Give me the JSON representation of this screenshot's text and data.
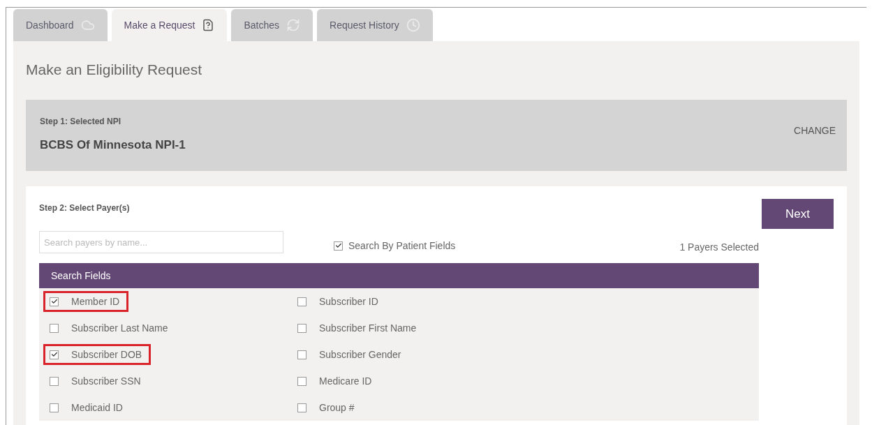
{
  "tabs": [
    {
      "label": "Dashboard",
      "selected": false
    },
    {
      "label": "Make a Request",
      "selected": true
    },
    {
      "label": "Batches",
      "selected": false
    },
    {
      "label": "Request History",
      "selected": false
    }
  ],
  "page_title": "Make an Eligibility Request",
  "step1": {
    "heading": "Step 1: Selected NPI",
    "value": "BCBS Of Minnesota NPI-1",
    "action": "CHANGE"
  },
  "step2": {
    "heading": "Step 2: Select Payer(s)",
    "search": {
      "placeholder": "Search payers by name..."
    },
    "patient_fields": {
      "label": "Search By Patient Fields",
      "checked": true
    },
    "count": "1 Payers Selected",
    "next": "Next",
    "section_title": "Search Fields",
    "fields": [
      {
        "label": "Member ID",
        "checked": true,
        "highlighted": true
      },
      {
        "label": "Subscriber ID",
        "checked": false,
        "highlighted": false
      },
      {
        "label": "Subscriber Last Name",
        "checked": false,
        "highlighted": false
      },
      {
        "label": "Subscriber First Name",
        "checked": false,
        "highlighted": false
      },
      {
        "label": "Subscriber DOB",
        "checked": true,
        "highlighted": true
      },
      {
        "label": "Subscriber Gender",
        "checked": false,
        "highlighted": false
      },
      {
        "label": "Subscriber SSN",
        "checked": false,
        "highlighted": false
      },
      {
        "label": "Medicare ID",
        "checked": false,
        "highlighted": false
      },
      {
        "label": "Medicaid ID",
        "checked": false,
        "highlighted": false
      },
      {
        "label": "Group #",
        "checked": false,
        "highlighted": false
      }
    ]
  }
}
